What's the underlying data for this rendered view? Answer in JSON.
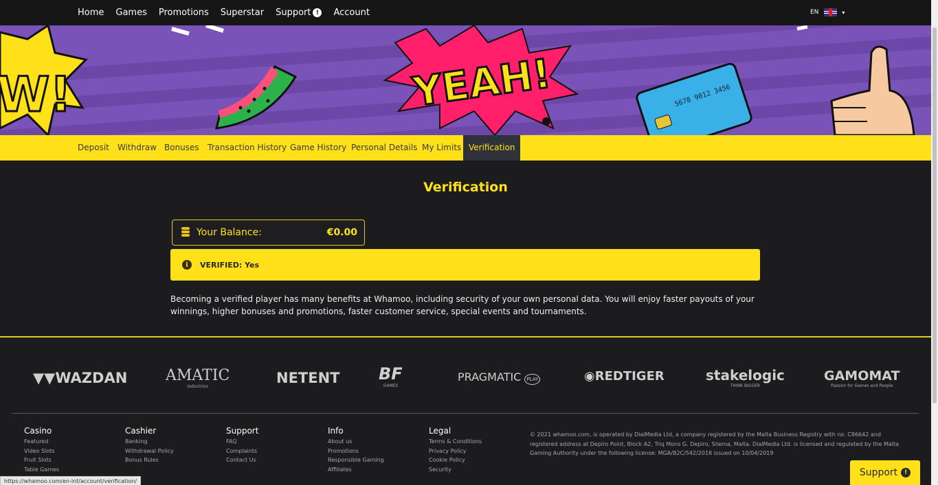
{
  "nav": {
    "items": [
      "Home",
      "Games",
      "Promotions",
      "Superstar",
      "Support",
      "Account"
    ],
    "support_badge": "!",
    "lang": "EN"
  },
  "banner": {
    "headline": "YEAH!",
    "card_number": "5678 9012 3456"
  },
  "tabs": [
    "Deposit",
    "Withdraw",
    "Bonuses",
    "Transaction History",
    "Game History",
    "Personal Details",
    "My Limits",
    "Verification"
  ],
  "active_tab": "Verification",
  "page_title": "Verification",
  "balance": {
    "label": "Your Balance:",
    "amount": "€0.00"
  },
  "verified": {
    "icon": "i",
    "text": "VERIFIED: Yes"
  },
  "description": "Becoming a verified player has many benefits at Whamoo, including security of your own personal data. You will enjoy faster payouts of your winnings, higher bonuses and promotions, faster customer service, special events and tournaments.",
  "providers": [
    {
      "name": "WAZDAN",
      "sub": ""
    },
    {
      "name": "AMATIC",
      "sub": "industries"
    },
    {
      "name": "NETENT",
      "sub": ""
    },
    {
      "name": "BF",
      "sub": "GAMES"
    },
    {
      "name": "PRAGMATIC",
      "sub": "PLAY"
    },
    {
      "name": "REDTIGER",
      "sub": ""
    },
    {
      "name": "stakelogic",
      "sub": "THINK BIGGER"
    },
    {
      "name": "GAMOMAT",
      "sub": "Passion for Games and People"
    }
  ],
  "footer": {
    "columns": [
      {
        "title": "Casino",
        "links": [
          "Featured",
          "Video Slots",
          "Fruit Slots",
          "Table Games"
        ]
      },
      {
        "title": "Cashier",
        "links": [
          "Banking",
          "Withdrawal Policy",
          "Bonus Rules"
        ]
      },
      {
        "title": "Support",
        "links": [
          "FAQ",
          "Complaints",
          "Contact Us"
        ]
      },
      {
        "title": "Info",
        "links": [
          "About us",
          "Promotions",
          "Responsible Gaming",
          "Affiliates"
        ]
      },
      {
        "title": "Legal",
        "links": [
          "Terms & Conditions",
          "Privacy Policy",
          "Cookie Policy",
          "Security"
        ]
      }
    ],
    "copyright": "© 2021 whamoo.com, is operated by DialMedia Ltd, a company registered by the Malta Business Registry with no. C86642 and registered address at Depiro Point, Block A2, Triq Mons G. Depiro, Sliema, Malta. DialMedia Ltd. is licensed and regulated by the Malta Gaming Authority under the following license: MGA/B2C/542/2018 issued on 10/04/2019"
  },
  "status_url": "https://whamoo.com/en-int/account/verification/",
  "support_button": {
    "label": "Support",
    "badge": "!"
  },
  "colors": {
    "accent": "#ffe11a",
    "dark": "#1c1c1e",
    "banner": "#7a53b8"
  }
}
